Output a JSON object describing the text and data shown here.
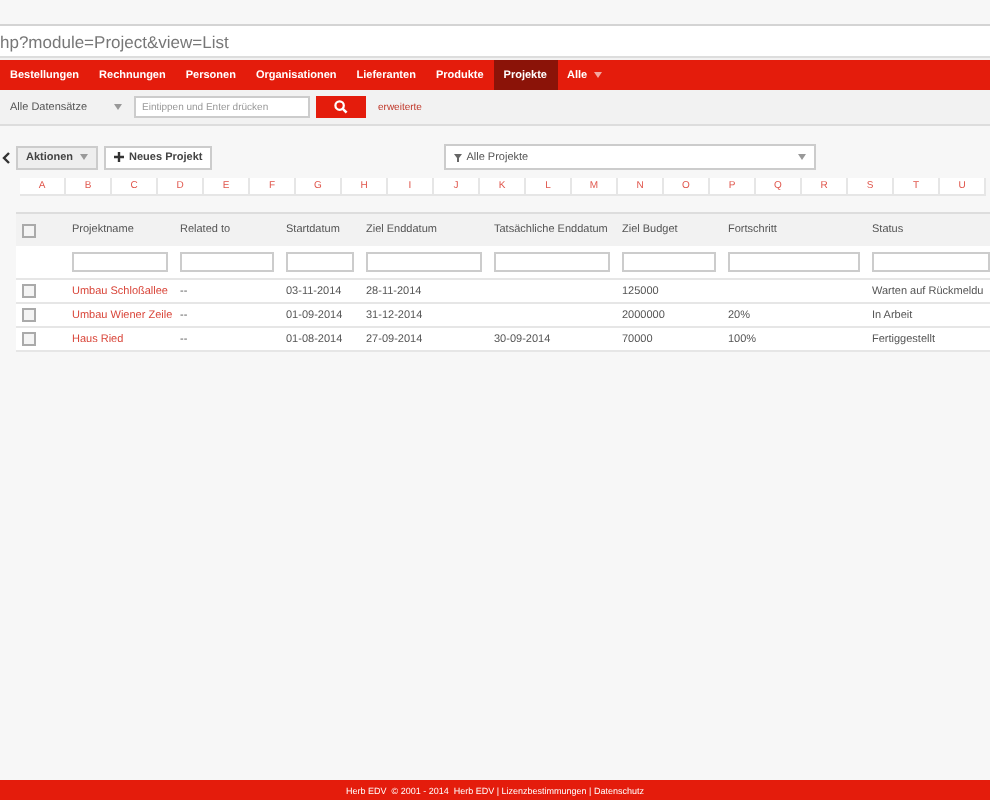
{
  "address_bar": {
    "url": "hp?module=Project&view=List"
  },
  "nav": [
    {
      "label": "Bestellungen",
      "selected": false
    },
    {
      "label": "Rechnungen",
      "selected": false
    },
    {
      "label": "Personen",
      "selected": false
    },
    {
      "label": "Organisationen",
      "selected": false
    },
    {
      "label": "Lieferanten",
      "selected": false
    },
    {
      "label": "Produkte",
      "selected": false
    },
    {
      "label": "Projekte",
      "selected": true
    },
    {
      "label": "Alle",
      "selected": false,
      "dropdown": true
    }
  ],
  "search": {
    "scope": "Alle Datensätze",
    "placeholder": "Eintippen und Enter drücken",
    "advanced": "erweiterte"
  },
  "toolbar": {
    "actions": "Aktionen",
    "new_button": "Neues Projekt",
    "filter": "Alle Projekte"
  },
  "letters": [
    "A",
    "B",
    "C",
    "D",
    "E",
    "F",
    "G",
    "H",
    "I",
    "J",
    "K",
    "L",
    "M",
    "N",
    "O",
    "P",
    "Q",
    "R",
    "S",
    "T",
    "U"
  ],
  "table": {
    "select_all": {
      "checked": false
    },
    "columns": [
      "Projektname",
      "Related to",
      "Startdatum",
      "Ziel Enddatum",
      "Tatsächliche Enddatum",
      "Ziel Budget",
      "Fortschritt",
      "Status"
    ],
    "rows": [
      {
        "checked": false,
        "cells": [
          "Umbau Schloßallee",
          "--",
          "03-11-2014",
          "28-11-2014",
          "",
          "125000",
          "",
          "Warten auf Rückmeldu"
        ]
      },
      {
        "checked": false,
        "cells": [
          "Umbau Wiener Zeile",
          "--",
          "01-09-2014",
          "31-12-2014",
          "",
          "2000000",
          "20%",
          "In Arbeit"
        ]
      },
      {
        "checked": false,
        "cells": [
          "Haus Ried",
          "--",
          "01-08-2014",
          "27-09-2014",
          "30-09-2014",
          "70000",
          "100%",
          "Fertiggestellt"
        ]
      }
    ]
  },
  "footer": "Herb EDV  © 2001 - 2014  Herb EDV | Lizenzbestimmungen | Datenschutz"
}
